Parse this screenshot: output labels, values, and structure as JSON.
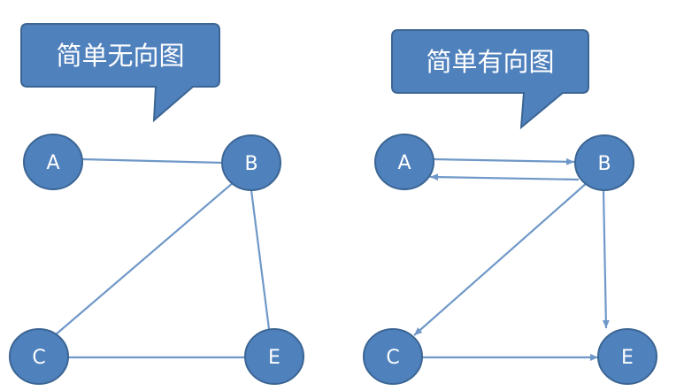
{
  "colors": {
    "node_fill": "#4f81bd",
    "node_stroke": "#3b6593",
    "edge": "#6f98c8",
    "callout_fill": "#4f81bd",
    "callout_stroke": "#3b6593",
    "text": "#ffffff"
  },
  "undirected": {
    "callout_label": "简单无向图",
    "nodes": {
      "A": "A",
      "B": "B",
      "C": "C",
      "E": "E"
    },
    "edges": [
      {
        "from": "A",
        "to": "B"
      },
      {
        "from": "B",
        "to": "C"
      },
      {
        "from": "B",
        "to": "E"
      },
      {
        "from": "C",
        "to": "E"
      }
    ]
  },
  "directed": {
    "callout_label": "简单有向图",
    "nodes": {
      "A": "A",
      "B": "B",
      "C": "C",
      "E": "E"
    },
    "edges": [
      {
        "from": "A",
        "to": "B"
      },
      {
        "from": "B",
        "to": "A"
      },
      {
        "from": "B",
        "to": "C"
      },
      {
        "from": "B",
        "to": "E"
      },
      {
        "from": "C",
        "to": "E"
      }
    ]
  }
}
